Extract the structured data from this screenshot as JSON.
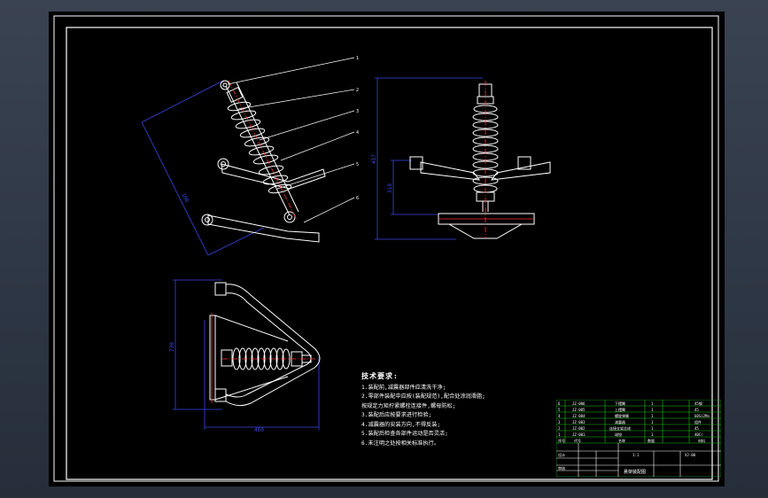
{
  "notes": {
    "heading": "技术要求:",
    "lines": [
      "1.装配前,减震器部件应清洗干净;",
      "2.零部件装配中应按(装配规范),配合处涂润滑脂;",
      "  按规定力矩拧紧螺栓连接件,螺母防松;",
      "3.装配后应按要求进行检验;",
      "4.减震器的安装方向,不得反装;",
      "5.装配后检查各部件运动是否灵活;",
      "6.未注明之处按相关标准执行。"
    ]
  },
  "leaders": [
    "1",
    "2",
    "3",
    "4",
    "5",
    "6"
  ],
  "dimensions": {
    "side_slant": "100",
    "front_height": "457",
    "front_lower": "310",
    "top_height": "730",
    "top_width": "460"
  },
  "title_block": {
    "rows": [
      {
        "no": "6",
        "code": "JZ-006",
        "name": "下摆臂",
        "qty": "1",
        "mat": "45钢"
      },
      {
        "no": "5",
        "code": "JZ-005",
        "name": "上摆臂",
        "qty": "1",
        "mat": "45"
      },
      {
        "no": "4",
        "code": "JZ-004",
        "name": "螺旋弹簧",
        "qty": "1",
        "mat": "60Si2Mn"
      },
      {
        "no": "3",
        "code": "JZ-003",
        "name": "减震器",
        "qty": "1",
        "mat": "组件"
      },
      {
        "no": "2",
        "code": "JZ-002",
        "name": "连接支架总成",
        "qty": "1",
        "mat": "45"
      },
      {
        "no": "1",
        "code": "JZ-001",
        "name": "球铰",
        "qty": "1",
        "mat": "40Cr"
      }
    ],
    "header": {
      "no": "序号",
      "code": "代号",
      "name": "名称",
      "qty": "数量",
      "mat": "材料"
    },
    "scale": "1:1",
    "drawing_no": "XJ-00",
    "title": "悬架装配图",
    "designer": "设计",
    "checker": "审核"
  },
  "colors": {
    "background": "#000000",
    "line": "#ffffff",
    "dimension": "#3b46e6",
    "center_line": "#ff3030",
    "table_green": "#19c419"
  }
}
